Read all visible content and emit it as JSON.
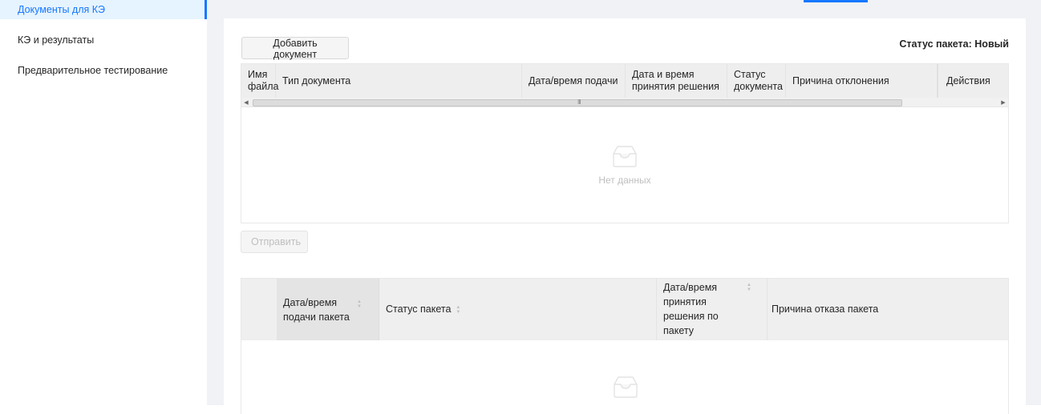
{
  "sidebar": {
    "items": [
      {
        "label": "Документы для КЭ",
        "active": true
      },
      {
        "label": "КЭ и результаты",
        "active": false
      },
      {
        "label": "Предварительное тестирование",
        "active": false
      }
    ],
    "collapse_icon": "menu-fold-icon"
  },
  "toolbar": {
    "add_document_label": "Добавить документ",
    "package_status_label": "Статус пакета:",
    "package_status_value": "Новый"
  },
  "documents_table": {
    "columns": [
      "Имя файла",
      "Тип документа",
      "Дата/время подачи",
      "Дата и время принятия решения",
      "Статус документа",
      "Причина отклонения",
      "Действия"
    ],
    "scroll_grip": "III",
    "empty_text": "Нет данных",
    "empty_icon": "inbox-icon"
  },
  "send_label": "Отправить",
  "packages_table": {
    "columns": [
      "",
      "Дата/время подачи пакета",
      "Статус пакета",
      "Дата/время принятия решения по пакету",
      "Причина отказа пакета"
    ],
    "empty_icon": "inbox-icon"
  },
  "colors": {
    "accent": "#1677ff",
    "header_bg": "#eeeeee",
    "page_bg": "#f0f2f5"
  }
}
